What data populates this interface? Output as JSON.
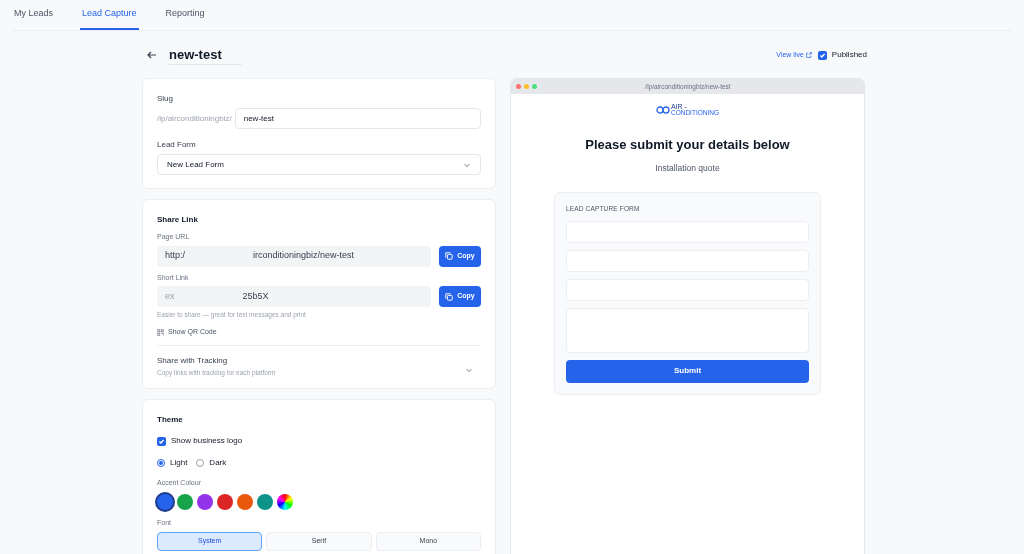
{
  "tabs": [
    {
      "label": "My Leads",
      "selected": false
    },
    {
      "label": "Lead Capture",
      "selected": true
    },
    {
      "label": "Reporting",
      "selected": false
    }
  ],
  "header": {
    "title": "new-test",
    "view_live": "View live",
    "published": {
      "label": "Published",
      "checked": true
    }
  },
  "slug": {
    "label": "Slug",
    "prefix": "/lp/airconditioningbiz/",
    "value": "new-test"
  },
  "lead_form": {
    "label": "Lead Form",
    "value": "New Lead Form"
  },
  "share_link": {
    "title": "Share Link",
    "page_url": {
      "label": "Page URL",
      "value_start": "http:/",
      "value_end": "irconditioningbiz/new-test",
      "button": "Copy"
    },
    "short_link": {
      "label": "Short Link",
      "value_start": "ex",
      "value_end": "25b5X",
      "button": "Copy"
    },
    "hint": "Easier to share — great for text messages and print",
    "qr": "Show QR Code"
  },
  "tracking": {
    "title": "Share with Tracking",
    "subtitle": "Copy links with tracking for each platform",
    "expanded": false
  },
  "theme": {
    "title": "Theme",
    "show_logo": {
      "label": "Show business logo",
      "checked": true
    },
    "modes": [
      {
        "label": "Light",
        "selected": true
      },
      {
        "label": "Dark",
        "selected": false
      }
    ],
    "accent_label": "Accent Colour",
    "accents": [
      {
        "kind": "swatch",
        "color": "#2563eb",
        "selected": true
      },
      {
        "kind": "swatch",
        "color": "#16a34a",
        "selected": false
      },
      {
        "kind": "swatch",
        "color": "#9333ea",
        "selected": false
      },
      {
        "kind": "swatch",
        "color": "#dc2626",
        "selected": false
      },
      {
        "kind": "swatch",
        "color": "#ea580c",
        "selected": false
      },
      {
        "kind": "swatch",
        "color": "#0d9488",
        "selected": false
      },
      {
        "kind": "custom",
        "selected": false
      }
    ],
    "font_label": "Font",
    "fonts": [
      {
        "label": "System",
        "selected": true
      },
      {
        "label": "Serif",
        "selected": false
      },
      {
        "label": "Mono",
        "selected": false
      }
    ]
  },
  "preview": {
    "url": "/lp/airconditioningbiz/new-test",
    "logo_line1": "AIR -",
    "logo_line2": "CONDITIONING",
    "heading": "Please submit your details below",
    "subheading": "Installation quote",
    "form_title": "LEAD CAPTURE FORM",
    "fields": [
      {
        "kind": "input"
      },
      {
        "kind": "input"
      },
      {
        "kind": "input"
      },
      {
        "kind": "textarea"
      }
    ],
    "submit": "Submit"
  }
}
